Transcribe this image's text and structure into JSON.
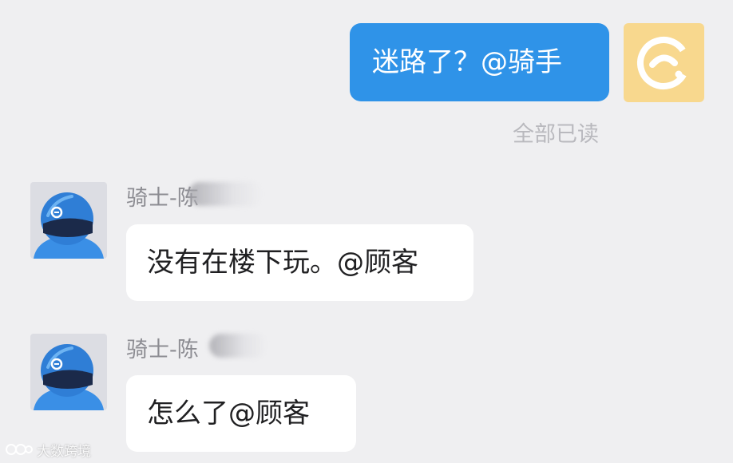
{
  "outgoing": {
    "text": "迷路了？@骑手",
    "read_status": "全部已读",
    "bubble_color": "#2f93e8"
  },
  "messages": [
    {
      "sender": "骑士-陈",
      "text": "没有在楼下玩。@顾客"
    },
    {
      "sender": "骑士-陈",
      "text": "怎么了@顾客"
    }
  ],
  "avatars": {
    "self": "eleme-logo-icon",
    "rider": "rider-helmet-icon"
  },
  "watermark": {
    "text": "大数跨境"
  },
  "colors": {
    "background": "#efeff1",
    "incoming_bubble": "#ffffff",
    "self_avatar_bg": "#f8d88e",
    "helmet_blue": "#3a8fe6"
  }
}
